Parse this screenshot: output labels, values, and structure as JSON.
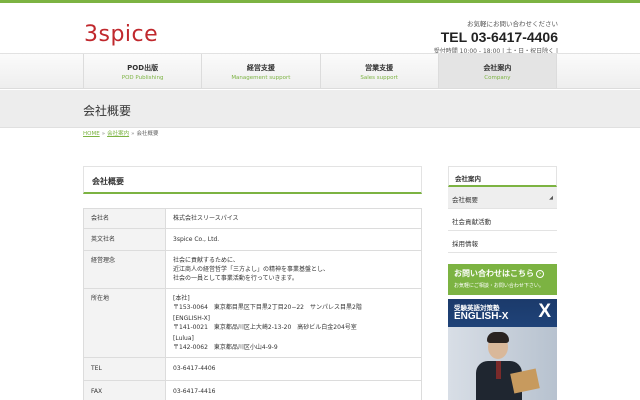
{
  "header": {
    "logo_text": "3spice",
    "contact_lead": "お気軽にお問い合わせください",
    "tel": "TEL 03-6417-4406",
    "hours": "受付時間 10:00 - 18:00 | 土・日・祝日除く |"
  },
  "nav": [
    {
      "label": "POD出版",
      "sub": "POD Publishing"
    },
    {
      "label": "経営支援",
      "sub": "Management support"
    },
    {
      "label": "営業支援",
      "sub": "Sales support"
    },
    {
      "label": "会社案内",
      "sub": "Company"
    }
  ],
  "page_title": "会社概要",
  "breadcrumb": {
    "home": "HOME",
    "sep": "»",
    "parent": "会社案内",
    "current": "会社概要"
  },
  "section_title": "会社概要",
  "profile": {
    "company_name_label": "会社名",
    "company_name_value": "株式会社スリースパイス",
    "english_name_label": "英文社名",
    "english_name_value": "3spice Co., Ltd.",
    "philosophy_label": "経営理念",
    "philosophy_line1": "社会に貢献するために、",
    "philosophy_line2": "近江商人の経営哲学「三方よし」の精神を事業基盤とし、",
    "philosophy_line3": "社会の一員として事業活動を行っていきます。",
    "address_label": "所在地",
    "addr1_name": "[本社]",
    "addr1_value": "〒153-0064　東京都目黒区下目黒2丁目20−22　サンパレス目黒2階",
    "addr2_name": "[ENGLISH-X]",
    "addr2_value": "〒141-0021　東京都品川区上大崎2-13-20　高砂ビル白金204号室",
    "addr3_name": "[Lulua]",
    "addr3_value": "〒142-0062　東京都品川区小山4-9-9",
    "tel_label": "TEL",
    "tel_value": "03-6417-4406",
    "fax_label": "FAX",
    "fax_value": "03-6417-4416"
  },
  "sidebar": {
    "heading": "会社案内",
    "items": [
      {
        "label": "会社概要"
      },
      {
        "label": "社会貢献活動"
      },
      {
        "label": "採用情報"
      }
    ],
    "active_arrow": "◢"
  },
  "banners": {
    "contact_main": "お問い合わせはこちら",
    "contact_arrow": "›",
    "contact_sub": "お気軽にご相談・お問い合わせ下さい。",
    "english_top": "受験英語対策塾",
    "english_brand": "ENGLISH-X",
    "english_mark": "X"
  },
  "colors": {
    "accent_green": "#7cb342",
    "logo_red": "#c0282d"
  }
}
